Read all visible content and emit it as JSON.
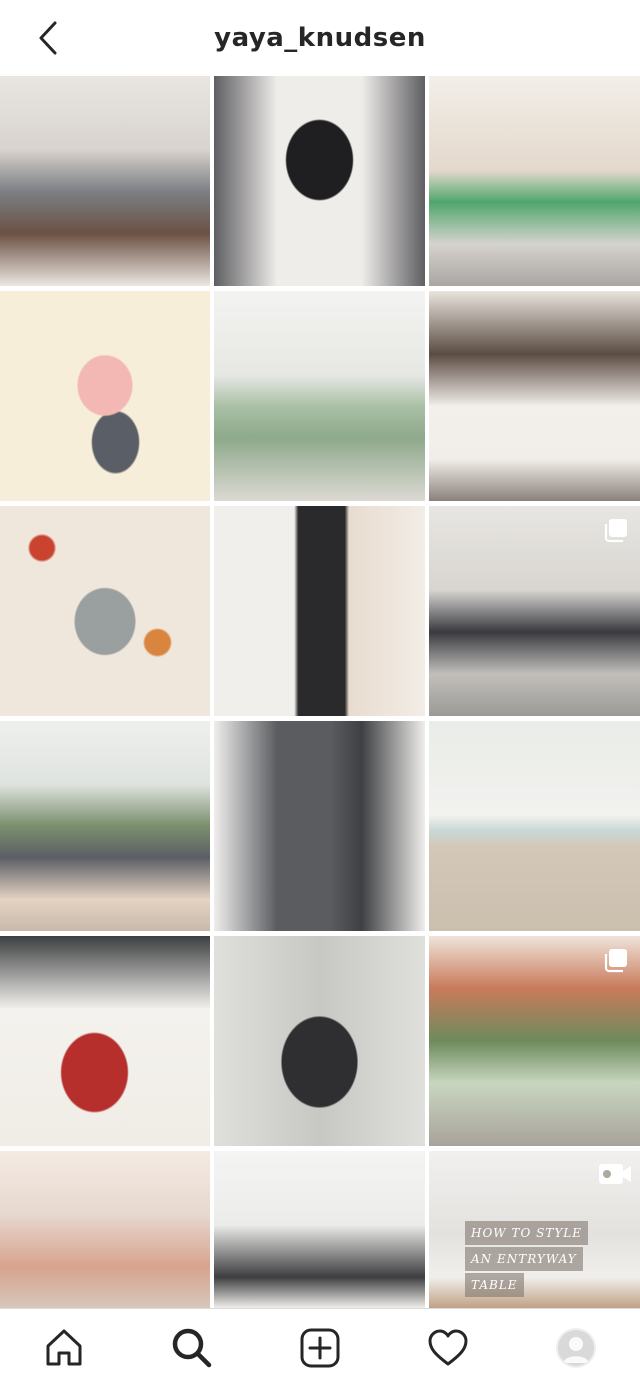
{
  "header": {
    "title": "yaya_knudsen",
    "back_icon": "chevron-left-icon"
  },
  "grid": {
    "posts": [
      {
        "kind": "photo",
        "badge": ""
      },
      {
        "kind": "photo",
        "badge": ""
      },
      {
        "kind": "photo",
        "badge": ""
      },
      {
        "kind": "photo",
        "badge": ""
      },
      {
        "kind": "photo",
        "badge": ""
      },
      {
        "kind": "photo",
        "badge": ""
      },
      {
        "kind": "photo",
        "badge": ""
      },
      {
        "kind": "photo",
        "badge": ""
      },
      {
        "kind": "carousel",
        "badge": "carousel-icon"
      },
      {
        "kind": "photo",
        "badge": ""
      },
      {
        "kind": "photo",
        "badge": ""
      },
      {
        "kind": "photo",
        "badge": ""
      },
      {
        "kind": "photo",
        "badge": ""
      },
      {
        "kind": "photo",
        "badge": ""
      },
      {
        "kind": "carousel",
        "badge": "carousel-icon"
      },
      {
        "kind": "photo",
        "badge": ""
      },
      {
        "kind": "photo",
        "badge": ""
      },
      {
        "kind": "video",
        "badge": "video-icon"
      }
    ],
    "overlay_text": {
      "line1": "HOW TO STYLE",
      "line2": "AN ENTRYWAY",
      "line3": "TABLE"
    }
  },
  "tabbar": {
    "items": [
      {
        "icon": "home-icon"
      },
      {
        "icon": "search-icon",
        "active": true
      },
      {
        "icon": "add-post-icon"
      },
      {
        "icon": "heart-icon"
      },
      {
        "icon": "profile-avatar"
      }
    ]
  }
}
